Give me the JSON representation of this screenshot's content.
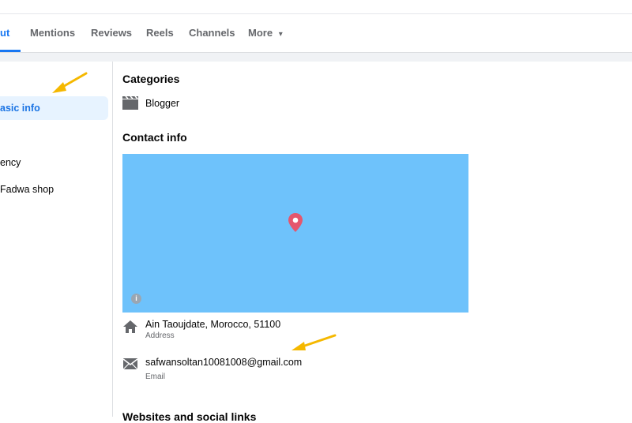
{
  "tabs": {
    "items": [
      {
        "label": "ut",
        "active": true
      },
      {
        "label": "Mentions",
        "active": false
      },
      {
        "label": "Reviews",
        "active": false
      },
      {
        "label": "Reels",
        "active": false
      },
      {
        "label": "Channels",
        "active": false
      },
      {
        "label": "More",
        "active": false
      }
    ],
    "more_caret": "▾"
  },
  "sidebar": {
    "items": [
      {
        "label": "asic info",
        "active": true
      },
      {
        "label": "ency",
        "active": false
      },
      {
        "label": " Fadwa shop",
        "active": false
      }
    ]
  },
  "categories": {
    "title": "Categories",
    "value": "Blogger"
  },
  "contact": {
    "title": "Contact info",
    "map_info_glyph": "i",
    "address": {
      "value": "Ain Taoujdate, Morocco, 51100",
      "label": "Address"
    },
    "email": {
      "value": "safwansoltan10081008@gmail.com",
      "label": "Email"
    }
  },
  "websites": {
    "title": "Websites and social links"
  },
  "colors": {
    "accent": "#1877f2",
    "map": "#6ec2fb",
    "pin": "#e5566d",
    "annotation_arrow": "#f5b800"
  }
}
